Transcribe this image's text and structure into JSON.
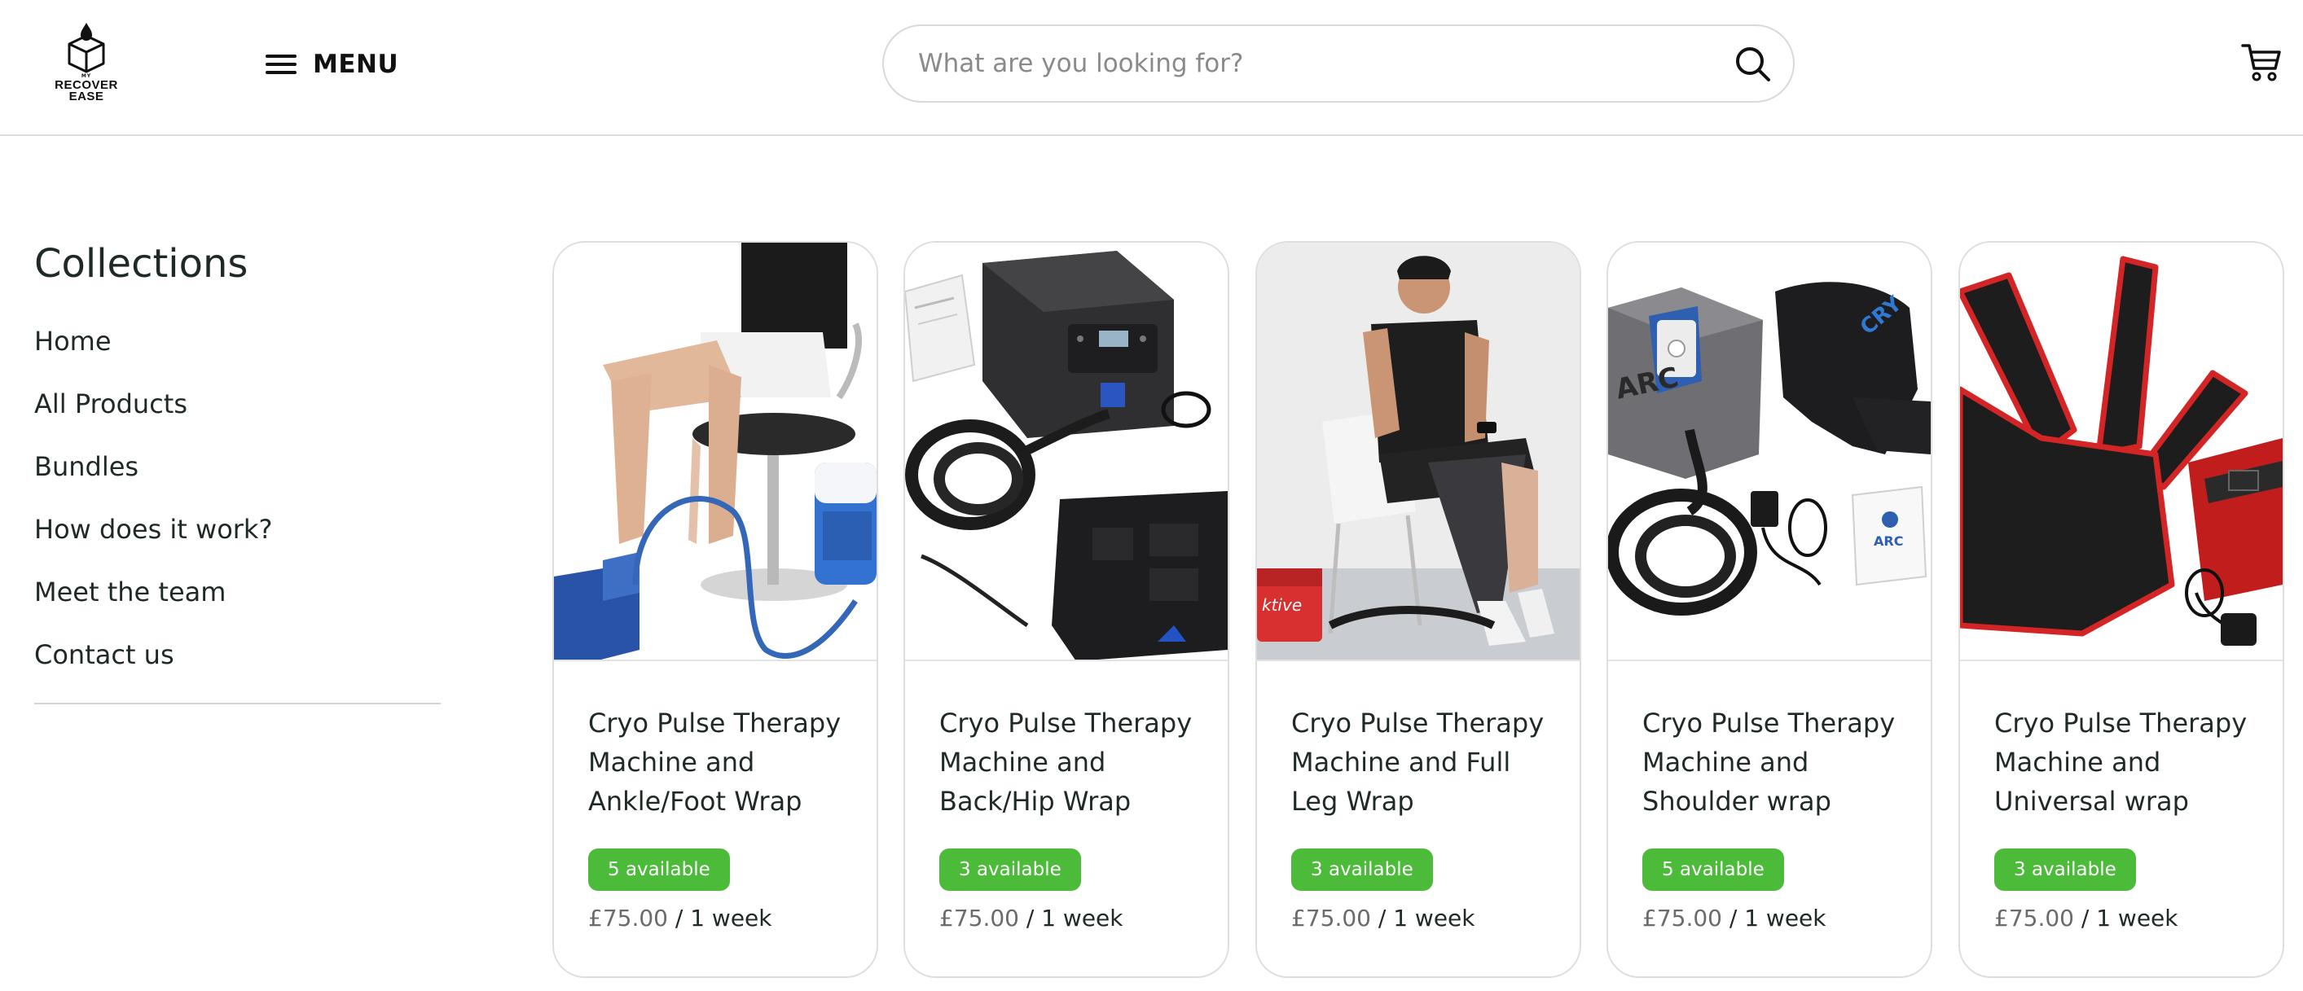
{
  "header": {
    "logo_small_text": "MY",
    "logo_text_line1": "RECOVER",
    "logo_text_line2": "EASE",
    "menu_label": "MENU",
    "search_placeholder": "What are you looking for?",
    "icons": [
      "menu-icon",
      "search-icon",
      "cart-icon"
    ]
  },
  "sidebar": {
    "title": "Collections",
    "items": [
      {
        "label": "Home"
      },
      {
        "label": "All Products"
      },
      {
        "label": "Bundles"
      },
      {
        "label": "How does it work?"
      },
      {
        "label": "Meet the team"
      },
      {
        "label": "Contact us"
      }
    ]
  },
  "products": [
    {
      "title": "Cryo Pulse Therapy Machine and Ankle/Foot Wrap",
      "availability": "5 available",
      "price": "£75.00",
      "period": " / 1 week"
    },
    {
      "title": "Cryo Pulse Therapy Machine and Back/Hip Wrap",
      "availability": "3 available",
      "price": "£75.00",
      "period": " / 1 week"
    },
    {
      "title": "Cryo Pulse Therapy Machine and Full Leg Wrap",
      "availability": "3 available",
      "price": "£75.00",
      "period": " / 1 week"
    },
    {
      "title": "Cryo Pulse Therapy Machine and Shoulder wrap",
      "availability": "5 available",
      "price": "£75.00",
      "period": " / 1 week"
    },
    {
      "title": "Cryo Pulse Therapy Machine and Universal wrap",
      "availability": "3 available",
      "price": "£75.00",
      "period": " / 1 week"
    }
  ],
  "colors": {
    "badge_green": "#4cbb3a",
    "text_dark": "#1f2a24",
    "price_gray": "#6b6b6b",
    "border": "#dedede"
  }
}
